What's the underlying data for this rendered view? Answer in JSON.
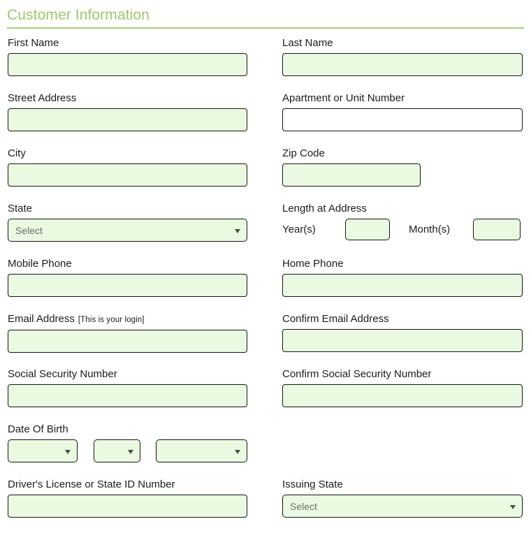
{
  "section": {
    "title": "Customer Information",
    "accent_color": "#9cc96a",
    "rule_color": "#a7cf72",
    "required_field_bg": "#eafae1",
    "optional_field_bg": "#ffffff",
    "field_border_color": "#151515"
  },
  "fields": {
    "first_name": {
      "label": "First Name",
      "value": "",
      "placeholder": ""
    },
    "last_name": {
      "label": "Last Name",
      "value": "",
      "placeholder": ""
    },
    "street_address": {
      "label": "Street Address",
      "value": "",
      "placeholder": ""
    },
    "apartment": {
      "label": "Apartment or Unit Number",
      "value": "",
      "placeholder": ""
    },
    "city": {
      "label": "City",
      "value": "",
      "placeholder": ""
    },
    "zip_code": {
      "label": "Zip Code",
      "value": "",
      "placeholder": ""
    },
    "state": {
      "label": "State",
      "selected": "Select"
    },
    "length_at_address": {
      "label": "Length at Address",
      "years_label": "Year(s)",
      "years_value": "",
      "months_label": "Month(s)",
      "months_value": ""
    },
    "mobile_phone": {
      "label": "Mobile Phone",
      "value": "",
      "placeholder": ""
    },
    "home_phone": {
      "label": "Home Phone",
      "value": "",
      "placeholder": ""
    },
    "email": {
      "label": "Email Address",
      "note": "[This is your login]",
      "value": "",
      "placeholder": ""
    },
    "confirm_email": {
      "label": "Confirm Email Address",
      "value": "",
      "placeholder": ""
    },
    "ssn": {
      "label": "Social Security Number",
      "value": "",
      "placeholder": ""
    },
    "confirm_ssn": {
      "label": "Confirm Social Security Number",
      "value": "",
      "placeholder": ""
    },
    "date_of_birth": {
      "label": "Date Of Birth",
      "month_selected": "",
      "day_selected": "",
      "year_selected": ""
    },
    "drivers_license": {
      "label": "Driver's License or State ID Number",
      "value": "",
      "placeholder": ""
    },
    "issuing_state": {
      "label": "Issuing State",
      "selected": "Select"
    }
  }
}
